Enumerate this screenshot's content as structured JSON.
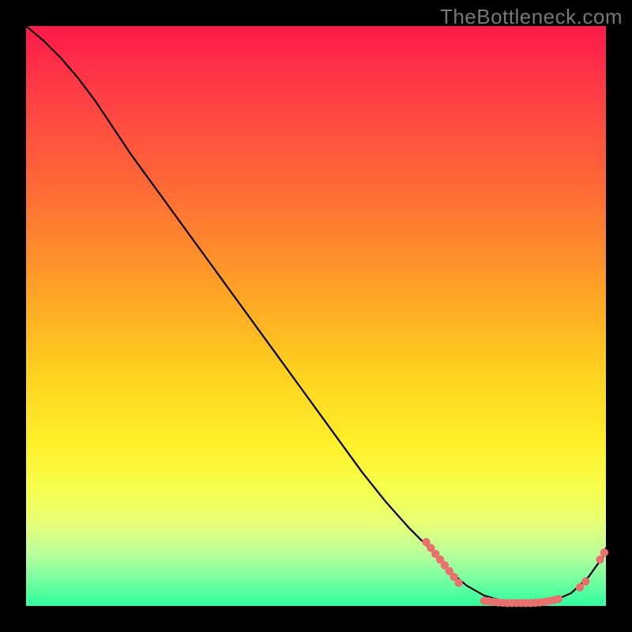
{
  "watermark": "TheBottleneck.com",
  "colors": {
    "dot": "#e9716d",
    "line": "#000000",
    "gradient_top": "#ff1a4b",
    "gradient_bottom": "#2eff9e",
    "frame_bg": "#000000"
  },
  "chart_data": {
    "type": "line",
    "title": "",
    "xlabel": "",
    "ylabel": "",
    "xlim": [
      0,
      100
    ],
    "ylim": [
      0,
      100
    ],
    "grid": false,
    "legend": false,
    "series": [
      {
        "name": "curve",
        "x": [
          0,
          3,
          6,
          9,
          12,
          15,
          18,
          22,
          26,
          30,
          34,
          38,
          42,
          46,
          50,
          54,
          58,
          62,
          66,
          70,
          73,
          76,
          79,
          82,
          85,
          88,
          91,
          94,
          97,
          99.5,
          100
        ],
        "y": [
          100,
          97.5,
          94.5,
          91,
          87,
          82.5,
          78,
          72.5,
          67,
          61.5,
          56,
          50.5,
          45,
          39.5,
          34,
          28.5,
          23,
          18,
          13.5,
          9.5,
          6,
          3.5,
          1.8,
          0.9,
          0.5,
          0.5,
          0.9,
          2.2,
          5,
          8.5,
          10
        ]
      }
    ],
    "dot_clusters": [
      {
        "name": "descent-cluster",
        "points": [
          {
            "x": 69.0,
            "y": 11.0
          },
          {
            "x": 69.8,
            "y": 10.0
          },
          {
            "x": 70.6,
            "y": 9.0
          },
          {
            "x": 71.4,
            "y": 8.0
          },
          {
            "x": 72.2,
            "y": 7.0
          },
          {
            "x": 73.0,
            "y": 6.0
          },
          {
            "x": 73.8,
            "y": 5.0
          },
          {
            "x": 74.6,
            "y": 4.0
          }
        ]
      },
      {
        "name": "valley-floor",
        "points": [
          {
            "x": 79.0,
            "y": 0.9
          },
          {
            "x": 79.8,
            "y": 0.8
          },
          {
            "x": 80.6,
            "y": 0.7
          },
          {
            "x": 81.4,
            "y": 0.6
          },
          {
            "x": 82.2,
            "y": 0.55
          },
          {
            "x": 83.0,
            "y": 0.5
          },
          {
            "x": 83.8,
            "y": 0.5
          },
          {
            "x": 84.6,
            "y": 0.5
          },
          {
            "x": 85.4,
            "y": 0.5
          },
          {
            "x": 86.2,
            "y": 0.5
          },
          {
            "x": 87.0,
            "y": 0.5
          },
          {
            "x": 87.8,
            "y": 0.55
          },
          {
            "x": 88.6,
            "y": 0.6
          },
          {
            "x": 89.4,
            "y": 0.7
          },
          {
            "x": 90.2,
            "y": 0.85
          },
          {
            "x": 91.0,
            "y": 1.0
          },
          {
            "x": 91.8,
            "y": 1.2
          }
        ]
      },
      {
        "name": "ascent-small",
        "points": [
          {
            "x": 95.5,
            "y": 3.2
          },
          {
            "x": 96.5,
            "y": 4.2
          }
        ]
      },
      {
        "name": "ascent-top",
        "points": [
          {
            "x": 99.0,
            "y": 8.0
          },
          {
            "x": 99.7,
            "y": 9.2
          }
        ]
      }
    ]
  }
}
